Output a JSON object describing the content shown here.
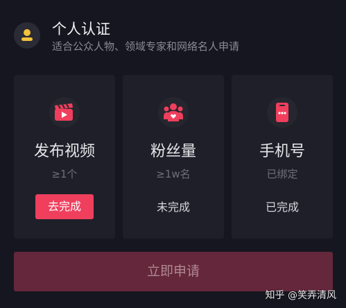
{
  "header": {
    "title": "个人认证",
    "subtitle": "适合公众人物、领域专家和网络名人申请"
  },
  "cards": [
    {
      "icon": "video-clapper-icon",
      "label": "发布视频",
      "requirement": "≥1个",
      "status": "去完成",
      "status_is_button": true
    },
    {
      "icon": "fans-icon",
      "label": "粉丝量",
      "requirement": "≥1w名",
      "status": "未完成",
      "status_is_button": false
    },
    {
      "icon": "phone-icon",
      "label": "手机号",
      "requirement": "已绑定",
      "status": "已完成",
      "status_is_button": false
    }
  ],
  "apply_button": {
    "label": "立即申请"
  },
  "watermark": "知乎 @笑弄清风",
  "colors": {
    "background": "#161620",
    "card": "#1f1f2a",
    "accent": "#ef3f5d",
    "accent_dim": "#65273b",
    "avatar_icon": "#f3c23a"
  }
}
